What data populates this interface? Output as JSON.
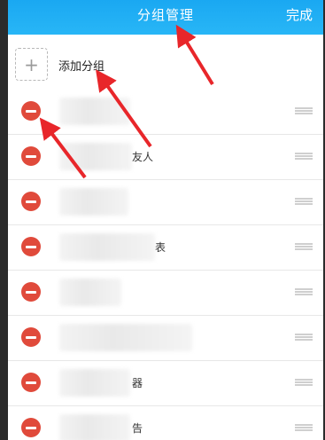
{
  "header": {
    "title": "分组管理",
    "done_label": "完成"
  },
  "add_group": {
    "icon": "plus-icon",
    "label": "添加分组"
  },
  "groups": [
    {
      "visible_text": ""
    },
    {
      "visible_text": "友人"
    },
    {
      "visible_text": ""
    },
    {
      "visible_text": "表"
    },
    {
      "visible_text": ""
    },
    {
      "visible_text": ""
    },
    {
      "visible_text": "器"
    },
    {
      "visible_text": "告"
    }
  ],
  "colors": {
    "header": "#1aa8f2",
    "delete": "#e04a3b",
    "annotation_arrow": "#e8262a"
  }
}
